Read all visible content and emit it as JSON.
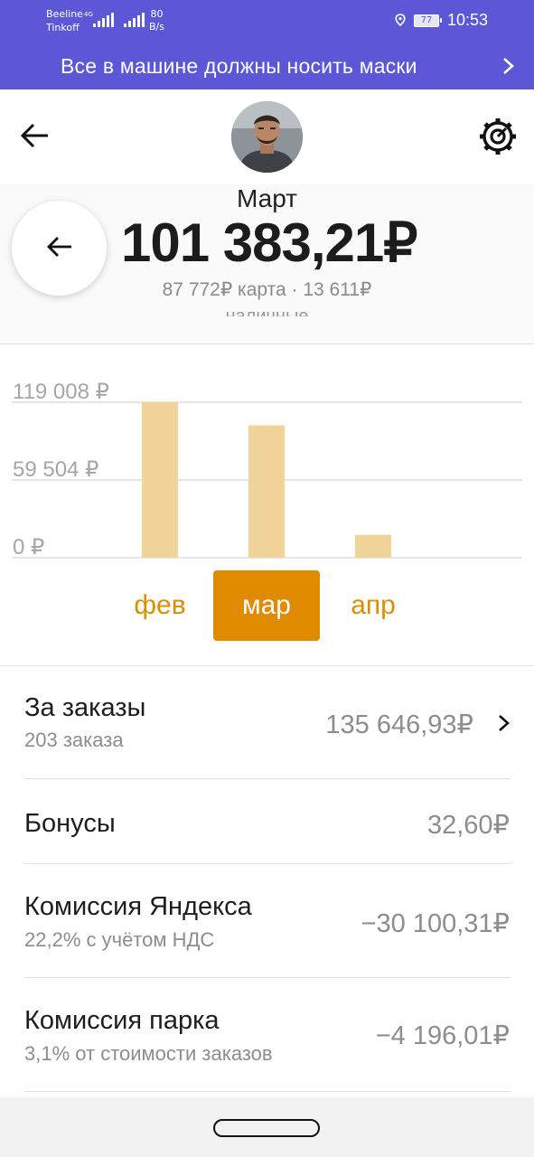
{
  "status_bar": {
    "carrier1": "Beeline",
    "carrier2": "Tinkoff",
    "net1": "4G",
    "speed_value": "80",
    "speed_unit": "B/s",
    "battery": "77",
    "time": "10:53"
  },
  "banner": {
    "text": "Все в машине должны носить маски"
  },
  "summary": {
    "month": "Март",
    "total": "101 383,21₽",
    "breakdown": "87 772₽ карта · 13 611₽",
    "breakdown_more": "наличные"
  },
  "chart_data": {
    "type": "bar",
    "categories": [
      "фев",
      "мар",
      "апр"
    ],
    "values": [
      119008,
      101383.21,
      17500
    ],
    "tick_labels": [
      "119 008 ₽",
      "59 504 ₽",
      "0 ₽"
    ],
    "ticks": [
      119008,
      59504,
      0
    ],
    "ylim": [
      0,
      119008
    ],
    "selected": "мар",
    "bar_color": "#f0d49a",
    "accent_color": "#e08a00"
  },
  "rows": [
    {
      "title": "За заказы",
      "subtitle": "203 заказа",
      "value": "135 646,93₽",
      "chevron": true
    },
    {
      "title": "Бонусы",
      "subtitle": "",
      "value": "32,60₽",
      "chevron": false
    },
    {
      "title": "Комиссия Яндекса",
      "subtitle": "22,2% с учётом НДС",
      "value": "−30 100,31₽",
      "chevron": false
    },
    {
      "title": "Комиссия парка",
      "subtitle": "3,1% от стоимости заказов",
      "value": "−4 196,01₽",
      "chevron": false
    }
  ],
  "colors": {
    "top_bar": "#5b57d6",
    "accent": "#e08a00"
  }
}
